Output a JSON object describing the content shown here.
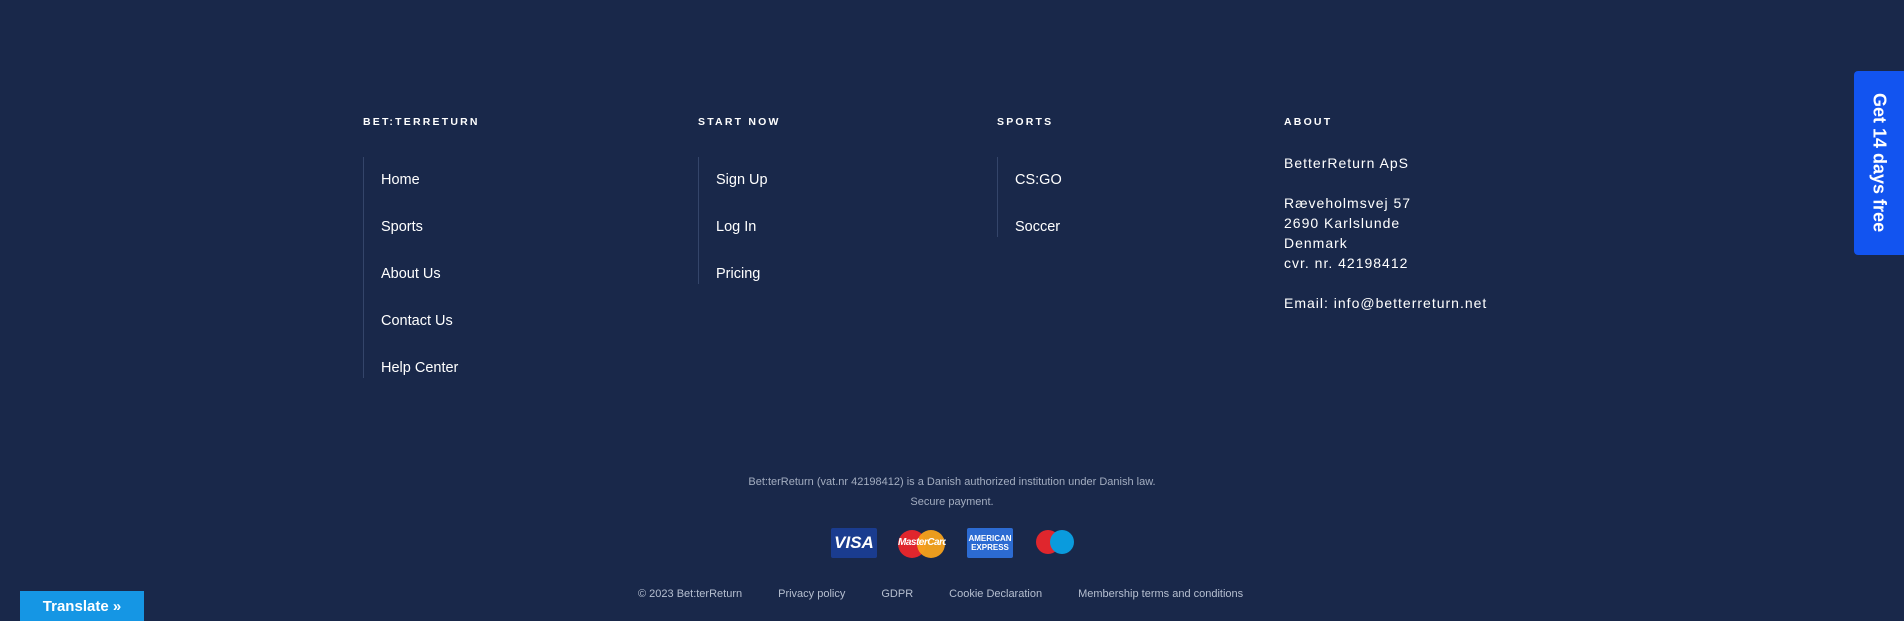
{
  "columns": [
    {
      "heading": "BET:TERRETURN",
      "links": [
        "Home",
        "Sports",
        "About Us",
        "Contact Us",
        "Help Center"
      ]
    },
    {
      "heading": "START NOW",
      "links": [
        "Sign Up",
        "Log In",
        "Pricing"
      ]
    },
    {
      "heading": "SPORTS",
      "links": [
        "CS:GO",
        "Soccer"
      ]
    }
  ],
  "about": {
    "heading": "ABOUT",
    "company": "BetterReturn ApS",
    "address": [
      "Ræveholmsvej 57",
      "2690 Karlslunde",
      "Denmark",
      "cvr. nr. 42198412"
    ],
    "email": "Email: info@betterreturn.net"
  },
  "legal": {
    "line1": "Bet:terReturn (vat.nr 42198412) is a Danish authorized institution under  Danish law.",
    "line2": "Secure payment."
  },
  "payments": [
    {
      "name": "visa",
      "label": "VISA"
    },
    {
      "name": "mastercard",
      "label": "MasterCard"
    },
    {
      "name": "american-express",
      "label": "AMERICAN EXPRESS"
    },
    {
      "name": "maestro",
      "label": ""
    }
  ],
  "footer_links": [
    "© 2023 Bet:terReturn",
    "Privacy policy",
    "GDPR",
    "Cookie Declaration",
    "Membership terms and conditions"
  ],
  "trial_tab": "Get 14 days free",
  "translate": "Translate »",
  "colors": {
    "background": "#19284a",
    "accent": "#1254f0",
    "translate": "#1596e4"
  }
}
